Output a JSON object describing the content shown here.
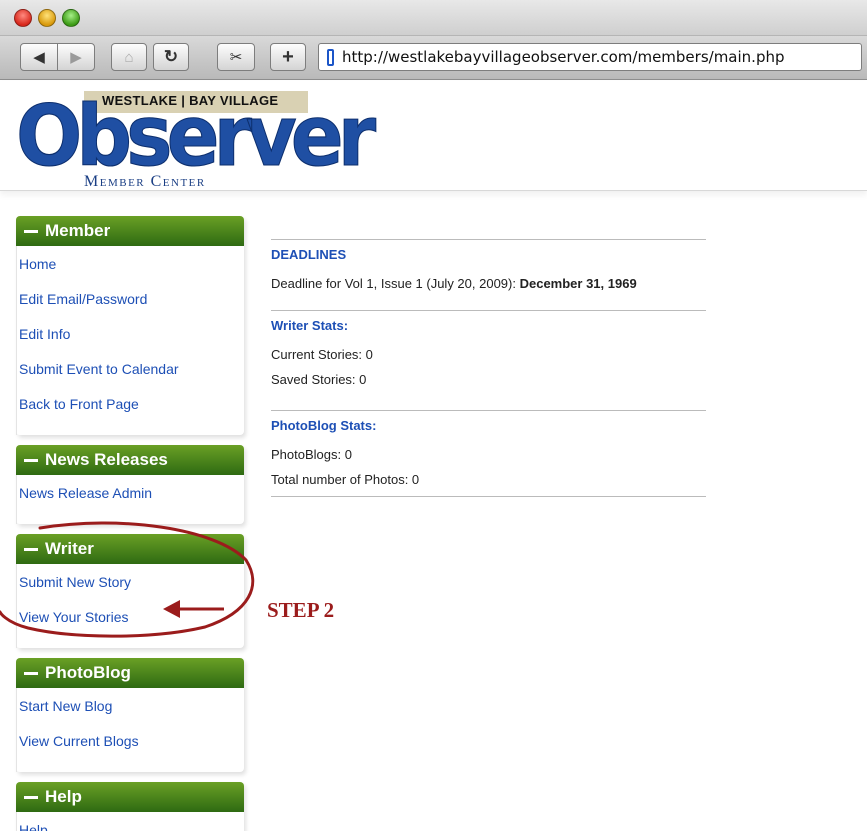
{
  "browser": {
    "url": "http://westlakebayvillageobserver.com/members/main.php",
    "buttons": {
      "back": "◀",
      "forward": "▶",
      "home": "⌂",
      "reload": "↻",
      "snip": "✂",
      "add": "+"
    }
  },
  "header": {
    "band_text": "WESTLAKE | BAY VILLAGE",
    "logo_word": "Observer",
    "subtitle": "Member Center"
  },
  "sidebar": {
    "sections": [
      {
        "title": "Member",
        "links": [
          "Home",
          "Edit Email/Password",
          "Edit Info",
          "Submit Event to Calendar",
          "Back to Front Page"
        ]
      },
      {
        "title": "News Releases",
        "links": [
          "News Release Admin"
        ]
      },
      {
        "title": "Writer",
        "links": [
          "Submit New Story",
          "View Your Stories"
        ]
      },
      {
        "title": "PhotoBlog",
        "links": [
          "Start New Blog",
          "View Current Blogs"
        ]
      },
      {
        "title": "Help",
        "links": [
          "Help"
        ]
      }
    ]
  },
  "main": {
    "deadlines": {
      "title": "DEADLINES",
      "text": "Deadline for Vol 1, Issue 1 (July 20, 2009): ",
      "date": "December 31, 1969"
    },
    "writer_stats": {
      "title": "Writer Stats:",
      "current": "Current Stories: 0",
      "saved": "Saved Stories: 0"
    },
    "photoblog_stats": {
      "title": "PhotoBlog Stats:",
      "photoblogs": "PhotoBlogs: 0",
      "photos": "Total number of Photos: 0"
    }
  },
  "annotation": {
    "label": "STEP 2",
    "color": "#9b1c1c"
  },
  "colors": {
    "link": "#1d4fb5",
    "nav_green": "#4a8a1c",
    "logo_blue": "#1f4fa3"
  }
}
